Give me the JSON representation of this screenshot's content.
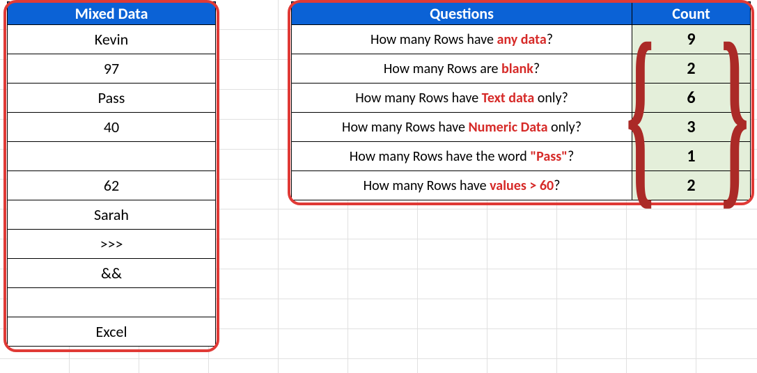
{
  "chart_data": {
    "type": "table",
    "mixed_data": [
      "Kevin",
      "97",
      "Pass",
      "40",
      "",
      "62",
      "Sarah",
      ">>>",
      "&&",
      "",
      "Excel"
    ],
    "questions": [
      {
        "q": "How many Rows have any data?",
        "a": 9
      },
      {
        "q": "How many Rows are blank?",
        "a": 2
      },
      {
        "q": "How many Rows have Text data only?",
        "a": 6
      },
      {
        "q": "How many Rows have Numeric Data only?",
        "a": 3
      },
      {
        "q": "How many Rows have the word \"Pass\"?",
        "a": 1
      },
      {
        "q": "How many Rows have values > 60?",
        "a": 2
      }
    ]
  },
  "headers": {
    "mixed": "Mixed Data",
    "questions": "Questions",
    "count": "Count"
  },
  "left_rows": {
    "r0": "Kevin",
    "r1": "97",
    "r2": "Pass",
    "r3": "40",
    "r4": "",
    "r5": "62",
    "r6": "Sarah",
    "r7": ">>>",
    "r8": "&&",
    "r9": "",
    "r10": "Excel"
  },
  "q": {
    "q0_a": "How many Rows have ",
    "q0_b": "any data",
    "q0_c": "?",
    "q1_a": "How many Rows are ",
    "q1_b": "blank",
    "q1_c": "?",
    "q2_a": "How many Rows have ",
    "q2_b": "Text data",
    "q2_c": " only?",
    "q3_a": "How many Rows have ",
    "q3_b": "Numeric Data",
    "q3_c": " only?",
    "q4_a": "How many Rows have the word ",
    "q4_b": "\"Pass\"",
    "q4_c": "?",
    "q5_a": "How many Rows have ",
    "q5_b": "values > 60",
    "q5_c": "?"
  },
  "counts": {
    "c0": "9",
    "c1": "2",
    "c2": "6",
    "c3": "3",
    "c4": "1",
    "c5": "2"
  },
  "braces": {
    "left": "{",
    "right": "}"
  }
}
